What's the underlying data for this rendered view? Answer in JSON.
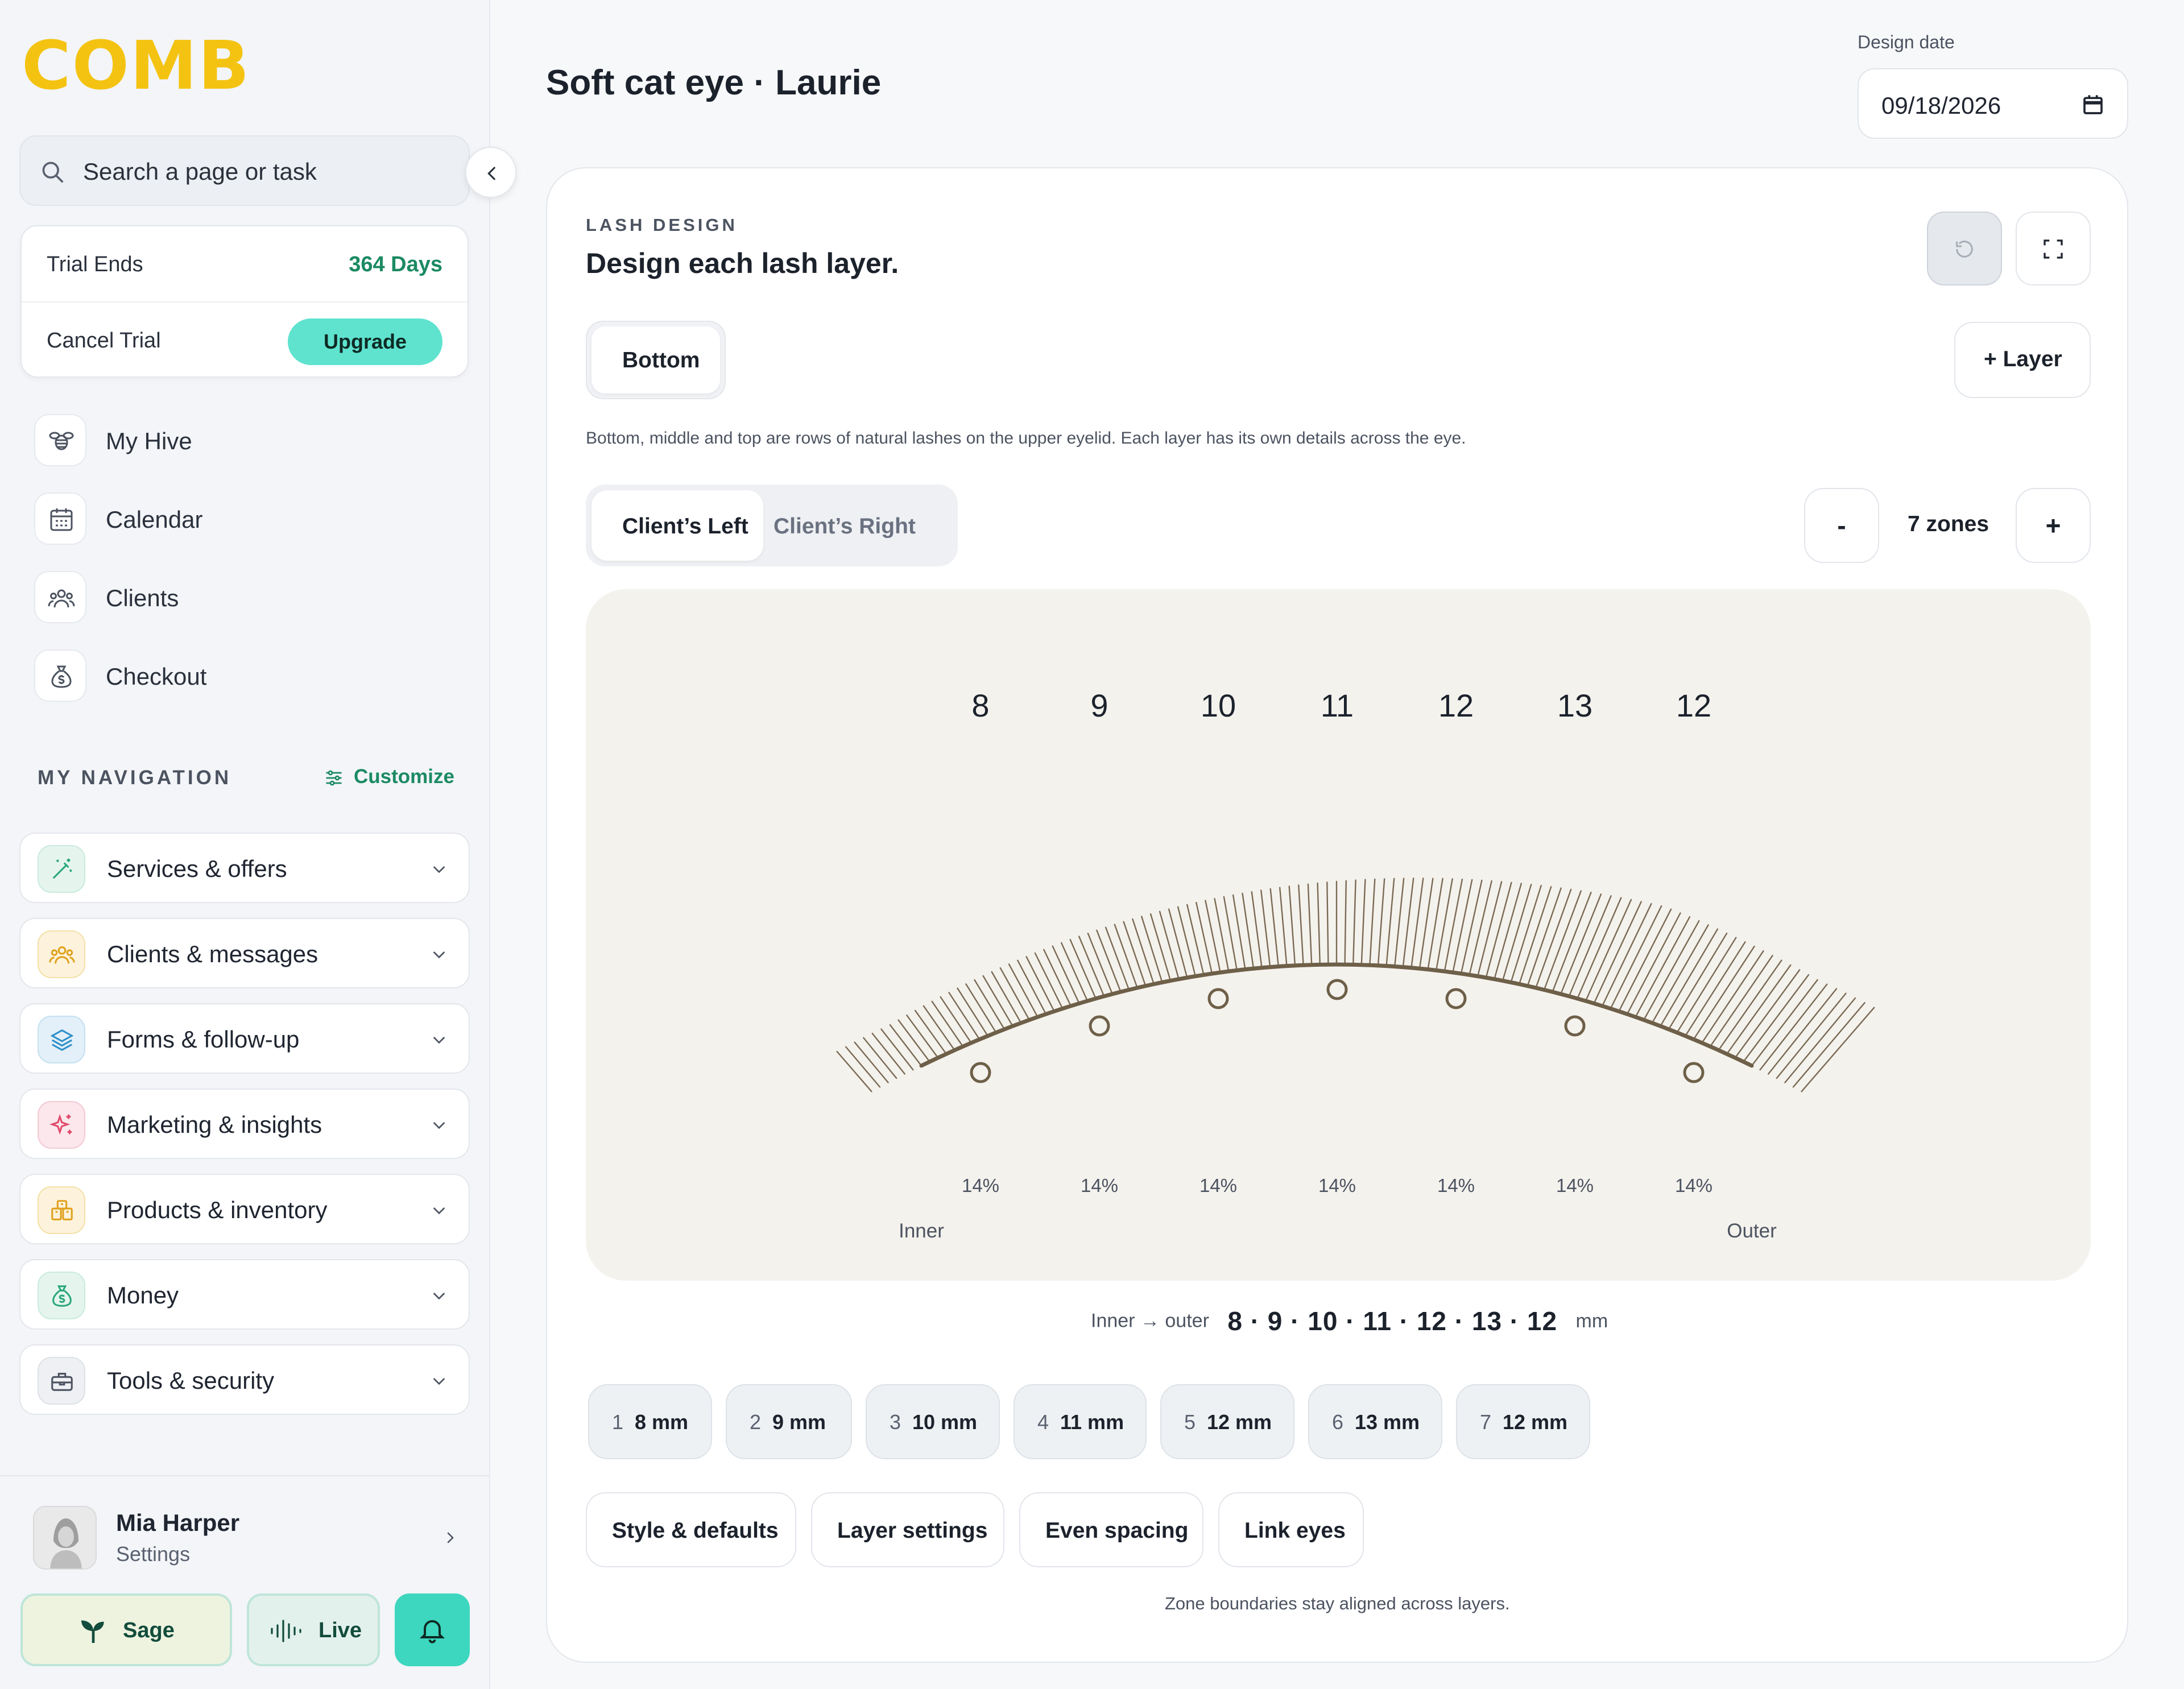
{
  "sidebar": {
    "logo": "COMB",
    "search_placeholder": "Search a page or task",
    "trial": {
      "label": "Trial Ends",
      "days": "364 Days",
      "cancel": "Cancel Trial",
      "upgrade": "Upgrade"
    },
    "primary": [
      {
        "label": "My Hive",
        "icon": "bee-icon"
      },
      {
        "label": "Calendar",
        "icon": "calendar-icon"
      },
      {
        "label": "Clients",
        "icon": "users-icon"
      },
      {
        "label": "Checkout",
        "icon": "money-bag-icon"
      }
    ],
    "my_navigation": "MY NAVIGATION",
    "customize": "Customize",
    "groups": [
      {
        "label": "Services & offers",
        "icon": "magic-wand-icon",
        "color": "#2aa67a"
      },
      {
        "label": "Clients & messages",
        "icon": "users-icon",
        "color": "#e0a11c"
      },
      {
        "label": "Forms & follow-up",
        "icon": "layers-icon",
        "color": "#2f8fc9"
      },
      {
        "label": "Marketing & insights",
        "icon": "sparkles-icon",
        "color": "#e04a6a"
      },
      {
        "label": "Products & inventory",
        "icon": "boxes-icon",
        "color": "#e0a11c"
      },
      {
        "label": "Money",
        "icon": "money-bag-icon",
        "color": "#2aa67a"
      },
      {
        "label": "Tools & security",
        "icon": "toolbox-icon",
        "color": "#4c5360"
      }
    ],
    "user": {
      "name": "Mia Harper",
      "sub": "Settings"
    },
    "sage": "Sage",
    "live": "Live"
  },
  "header": {
    "title": "Soft cat eye · Laurie",
    "date_label": "Design date",
    "date_value": "09/18/2026"
  },
  "card": {
    "eyebrow": "LASH DESIGN",
    "heading": "Design each lash layer.",
    "layer_tab": "Bottom",
    "add_layer": "+ Layer",
    "description": "Bottom, middle and top are rows of natural lashes on the upper eyelid. Each layer has its own details across the eye.",
    "eye_tabs": [
      "Client’s Left",
      "Client’s Right"
    ],
    "zone_minus": "-",
    "zone_count": "7 zones",
    "zone_plus": "+",
    "canvas": {
      "inner": "Inner",
      "outer": "Outer"
    },
    "summary": {
      "label": "Inner → outer",
      "sequence": "8 · 9 · 10 · 11 · 12 · 13 · 12",
      "unit": "mm"
    },
    "chips": [
      {
        "n": "1",
        "v": "8 mm"
      },
      {
        "n": "2",
        "v": "9 mm"
      },
      {
        "n": "3",
        "v": "10 mm"
      },
      {
        "n": "4",
        "v": "11 mm"
      },
      {
        "n": "5",
        "v": "12 mm"
      },
      {
        "n": "6",
        "v": "13 mm"
      },
      {
        "n": "7",
        "v": "12 mm"
      }
    ],
    "actions": [
      "Style & defaults",
      "Layer settings",
      "Even spacing",
      "Link eyes"
    ],
    "footnote": "Zone boundaries stay aligned across layers."
  },
  "chart_data": {
    "type": "line",
    "categories": [
      "1",
      "2",
      "3",
      "4",
      "5",
      "6",
      "7"
    ],
    "values": [
      8,
      9,
      10,
      11,
      12,
      13,
      12
    ],
    "percents": [
      "14%",
      "14%",
      "14%",
      "14%",
      "14%",
      "14%",
      "14%"
    ],
    "unit": "mm",
    "x_start_label": "Inner",
    "x_end_label": "Outer",
    "colors": {
      "lid": "#6e5f48",
      "lash": "#7a6a54",
      "canvas": "#f4f2ed"
    }
  }
}
